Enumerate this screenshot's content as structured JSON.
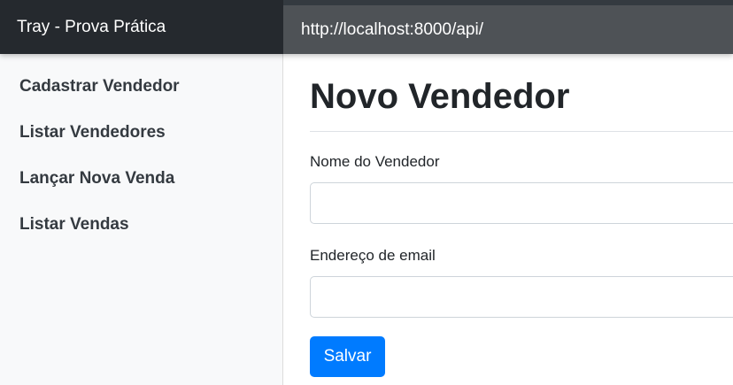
{
  "navbar": {
    "brand": "Tray - Prova Prática",
    "url": "http://localhost:8000/api/"
  },
  "sidebar": {
    "items": [
      {
        "label": "Cadastrar Vendedor"
      },
      {
        "label": "Listar Vendedores"
      },
      {
        "label": "Lançar Nova Venda"
      },
      {
        "label": "Listar Vendas"
      }
    ]
  },
  "main": {
    "title": "Novo Vendedor",
    "form": {
      "name_label": "Nome do Vendedor",
      "name_value": "",
      "email_label": "Endereço de email",
      "email_value": "",
      "submit_label": "Salvar"
    }
  },
  "colors": {
    "navbar_bg": "#343a40",
    "brand_bg": "#25292e",
    "sidebar_bg": "#f8f9fa",
    "primary": "#007bff"
  }
}
